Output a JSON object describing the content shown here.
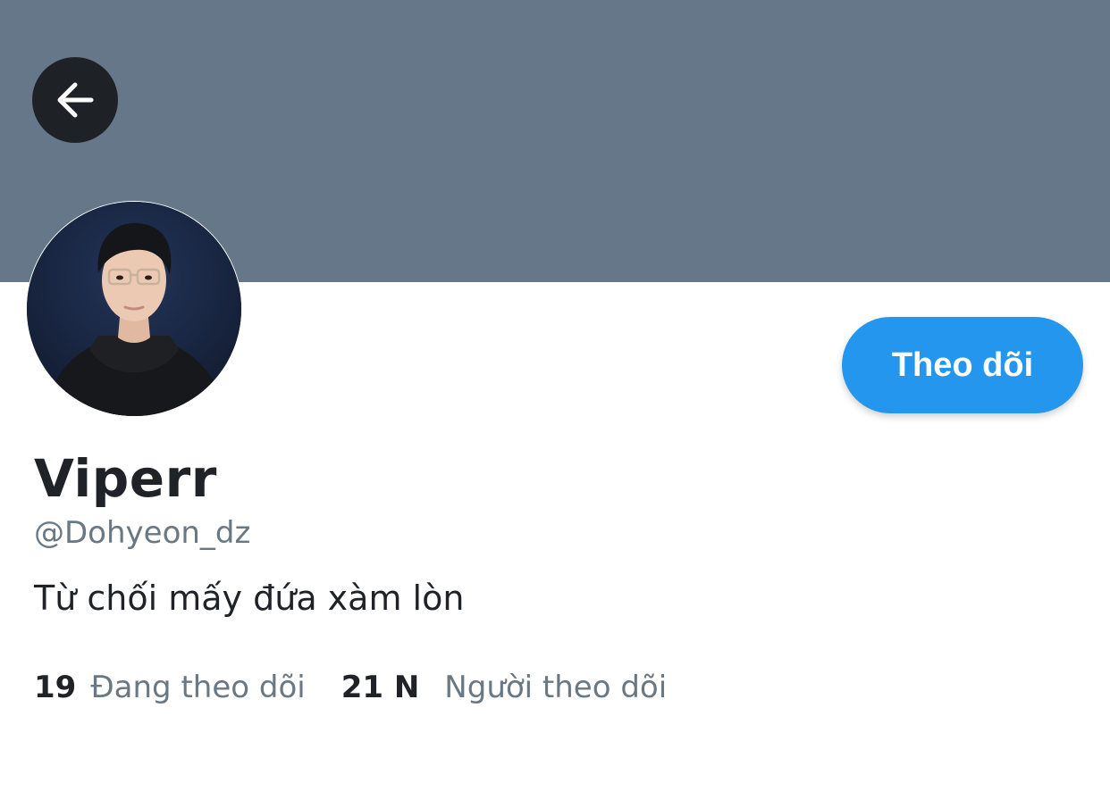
{
  "colors": {
    "banner": "#66778a",
    "accent": "#2496ee",
    "text_primary": "#1f2328",
    "text_secondary": "#6a7884"
  },
  "header": {
    "back_icon": "arrow-left-icon"
  },
  "profile": {
    "display_name": "Viperr",
    "handle": "@Dohyeon_dz",
    "bio": "Từ chối mấy đứa xàm lòn",
    "follow_label": "Theo dõi"
  },
  "stats": {
    "following_count": "19",
    "following_label": "Đang theo dõi",
    "followers_count": "21 N",
    "followers_label": "Người theo dõi"
  }
}
